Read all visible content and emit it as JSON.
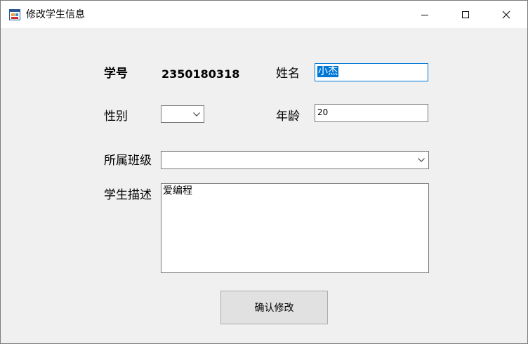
{
  "window": {
    "title": "修改学生信息",
    "icons": {
      "app": "app-form-icon",
      "minimize": "minimize-icon",
      "maximize": "maximize-icon",
      "close": "close-icon"
    }
  },
  "form": {
    "student_id_label": "学号",
    "student_id_value": "2350180318",
    "name_label": "姓名",
    "name_value": "小杰",
    "gender_label": "性别",
    "gender_value": "",
    "age_label": "年龄",
    "age_value": "20",
    "class_label": "所属班级",
    "class_value": "",
    "description_label": "学生描述",
    "description_value": "爱编程",
    "confirm_button": "确认修改"
  },
  "colors": {
    "focus_border": "#0078d7",
    "selection": "#0078d7",
    "window_bg": "#f0f0f0"
  }
}
